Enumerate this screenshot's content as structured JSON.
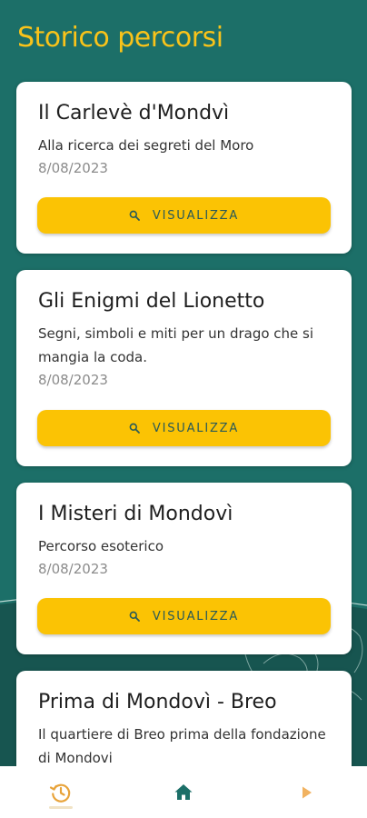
{
  "header": {
    "title": "Storico percorsi"
  },
  "routes": [
    {
      "title": "Il Carlevè d'Mondvì",
      "description": "Alla ricerca dei segreti del Moro",
      "date": "8/08/2023",
      "button_label": "VISUALIZZA"
    },
    {
      "title": "Gli Enigmi del Lionetto",
      "description": "Segni, simboli e miti per un drago che si mangia la coda.",
      "date": "8/08/2023",
      "button_label": "VISUALIZZA"
    },
    {
      "title": "I Misteri di Mondovì",
      "description": "Percorso esoterico",
      "date": "8/08/2023",
      "button_label": "VISUALIZZA"
    },
    {
      "title": "Prima di Mondovì - Breo",
      "description": "Il quartiere di Breo prima della fondazione di Mondovi"
    }
  ],
  "bottom_nav": {
    "items": [
      {
        "icon": "history-icon",
        "active": true
      },
      {
        "icon": "home-icon",
        "active": false
      },
      {
        "icon": "play-icon",
        "active": false
      }
    ]
  },
  "colors": {
    "background": "#1c6f68",
    "accent": "#fbc304",
    "title": "#f9c31a",
    "nav_history": "#e8a33a",
    "nav_home": "#1c6f68",
    "nav_play": "#f1b260"
  }
}
